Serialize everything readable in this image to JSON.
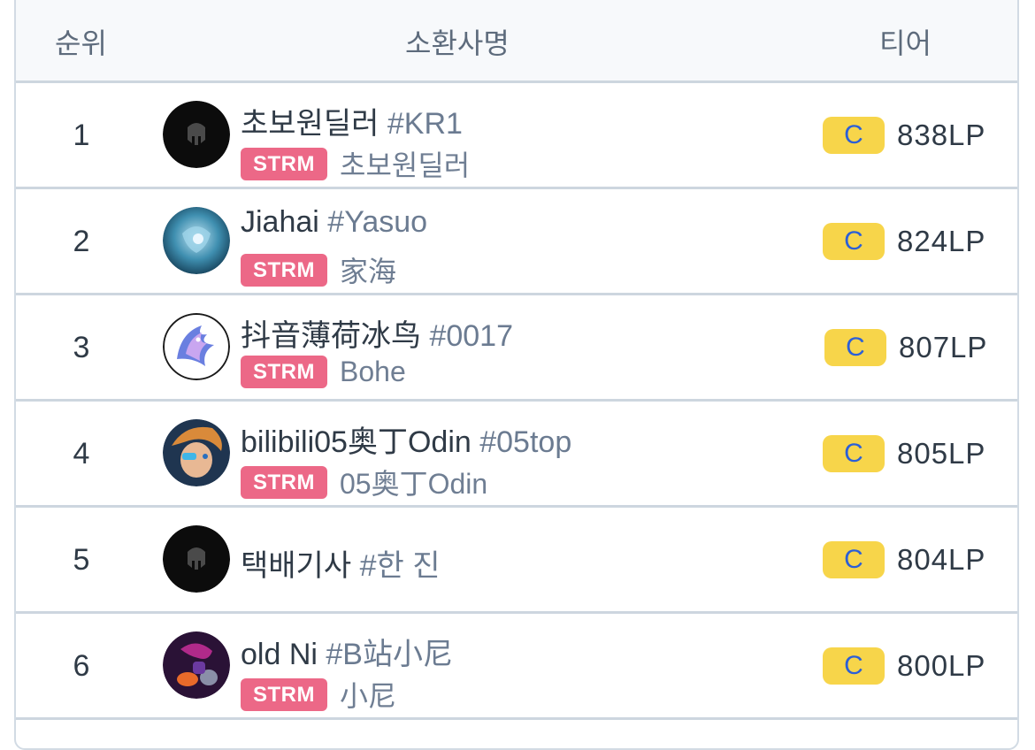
{
  "header": {
    "rank": "순위",
    "summoner": "소환사명",
    "tier": "티어"
  },
  "rows": [
    {
      "rank": "1",
      "name": "초보원딜러",
      "tag": "#KR1",
      "team": "STRM",
      "streamer": "초보원딜러",
      "tier": "C",
      "lp": "838LP",
      "avatar": "default-helmet"
    },
    {
      "rank": "2",
      "name": "Jiahai",
      "tag": "#Yasuo",
      "team": "STRM",
      "streamer": "家海",
      "tier": "C",
      "lp": "824LP",
      "avatar": "blue-champion"
    },
    {
      "rank": "3",
      "name": "抖音薄荷冰鸟",
      "tag": "#0017",
      "team": "STRM",
      "streamer": "Bohe",
      "tier": "C",
      "lp": "807LP",
      "avatar": "ice-phoenix"
    },
    {
      "rank": "4",
      "name": "bilibili05奥丁Odin",
      "tag": "#05top",
      "team": "STRM",
      "streamer": "05奥丁Odin",
      "tier": "C",
      "lp": "805LP",
      "avatar": "orange-hair-champion"
    },
    {
      "rank": "5",
      "name": "택배기사",
      "tag": "#한 진",
      "tier": "C",
      "lp": "804LP",
      "avatar": "default-helmet"
    },
    {
      "rank": "6",
      "name": "old Ni",
      "tag": "#B站小尼",
      "team": "STRM",
      "streamer": "小尼",
      "tier": "C",
      "lp": "800LP",
      "avatar": "purple-rider"
    }
  ],
  "colors": {
    "team_badge": "#ec6887",
    "tier_badge": "#f7d54a",
    "tier_text": "#2b5fd8"
  }
}
